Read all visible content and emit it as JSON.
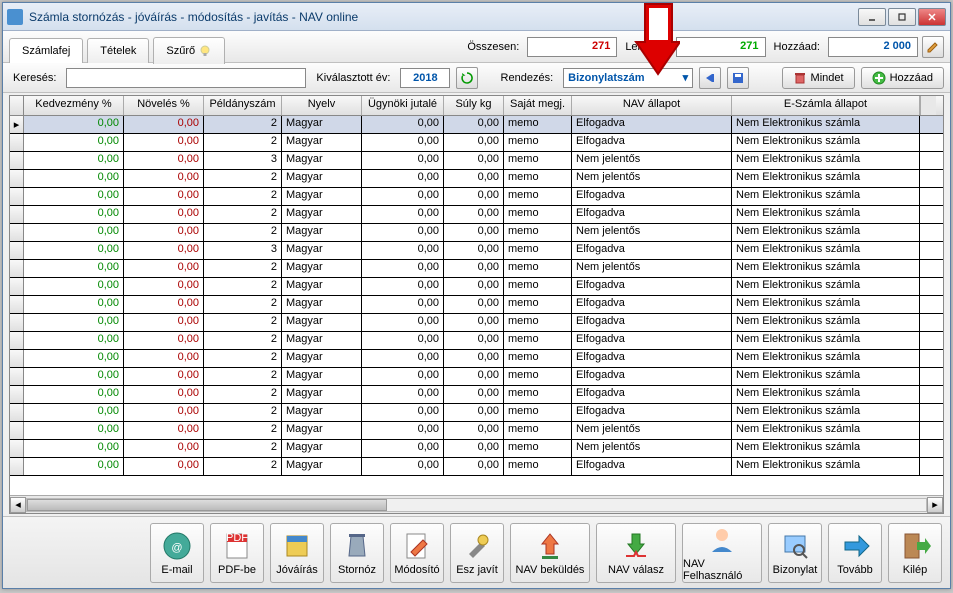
{
  "window": {
    "title": "Számla stornózás - jóváírás - módosítás - javítás - NAV online"
  },
  "tabs": {
    "t0": "Számlafej",
    "t1": "Tételek",
    "t2": "Szűrő"
  },
  "summary": {
    "osszesen_label": "Összesen:",
    "osszesen_value": "271",
    "lekerve_label": "Lekérve:",
    "lekerve_value": "271",
    "hozzaad_label": "Hozzáad:",
    "hozzaad_value": "2 000"
  },
  "toolbar2": {
    "kereses_label": "Keresés:",
    "kivalasztott_ev_label": "Kiválasztott év:",
    "year": "2018",
    "rendezes_label": "Rendezés:",
    "sort_field": "Bizonylatszám",
    "mindet_label": "Mindet",
    "hozzaad_label": "Hozzáad"
  },
  "columns": {
    "c0": "Kedvezmény %",
    "c1": "Növelés %",
    "c2": "Példányszám",
    "c3": "Nyelv",
    "c4": "Ügynöki jutalé",
    "c5": "Súly kg",
    "c6": "Saját megj.",
    "c7": "NAV állapot",
    "c8": "E-Számla állapot"
  },
  "rows": [
    {
      "kedv": "0,00",
      "nov": "0,00",
      "peld": "2",
      "nyelv": "Magyar",
      "jut": "0,00",
      "suly": "0,00",
      "megj": "memo",
      "nav": "Elfogadva",
      "esz": "Nem Elektronikus számla",
      "sel": true
    },
    {
      "kedv": "0,00",
      "nov": "0,00",
      "peld": "2",
      "nyelv": "Magyar",
      "jut": "0,00",
      "suly": "0,00",
      "megj": "memo",
      "nav": "Elfogadva",
      "esz": "Nem Elektronikus számla"
    },
    {
      "kedv": "0,00",
      "nov": "0,00",
      "peld": "3",
      "nyelv": "Magyar",
      "jut": "0,00",
      "suly": "0,00",
      "megj": "memo",
      "nav": "Nem jelentős",
      "esz": "Nem Elektronikus számla"
    },
    {
      "kedv": "0,00",
      "nov": "0,00",
      "peld": "2",
      "nyelv": "Magyar",
      "jut": "0,00",
      "suly": "0,00",
      "megj": "memo",
      "nav": "Nem jelentős",
      "esz": "Nem Elektronikus számla"
    },
    {
      "kedv": "0,00",
      "nov": "0,00",
      "peld": "2",
      "nyelv": "Magyar",
      "jut": "0,00",
      "suly": "0,00",
      "megj": "memo",
      "nav": "Elfogadva",
      "esz": "Nem Elektronikus számla"
    },
    {
      "kedv": "0,00",
      "nov": "0,00",
      "peld": "2",
      "nyelv": "Magyar",
      "jut": "0,00",
      "suly": "0,00",
      "megj": "memo",
      "nav": "Elfogadva",
      "esz": "Nem Elektronikus számla"
    },
    {
      "kedv": "0,00",
      "nov": "0,00",
      "peld": "2",
      "nyelv": "Magyar",
      "jut": "0,00",
      "suly": "0,00",
      "megj": "memo",
      "nav": "Nem jelentős",
      "esz": "Nem Elektronikus számla"
    },
    {
      "kedv": "0,00",
      "nov": "0,00",
      "peld": "3",
      "nyelv": "Magyar",
      "jut": "0,00",
      "suly": "0,00",
      "megj": "memo",
      "nav": "Elfogadva",
      "esz": "Nem Elektronikus számla"
    },
    {
      "kedv": "0,00",
      "nov": "0,00",
      "peld": "2",
      "nyelv": "Magyar",
      "jut": "0,00",
      "suly": "0,00",
      "megj": "memo",
      "nav": "Nem jelentős",
      "esz": "Nem Elektronikus számla"
    },
    {
      "kedv": "0,00",
      "nov": "0,00",
      "peld": "2",
      "nyelv": "Magyar",
      "jut": "0,00",
      "suly": "0,00",
      "megj": "memo",
      "nav": "Elfogadva",
      "esz": "Nem Elektronikus számla"
    },
    {
      "kedv": "0,00",
      "nov": "0,00",
      "peld": "2",
      "nyelv": "Magyar",
      "jut": "0,00",
      "suly": "0,00",
      "megj": "memo",
      "nav": "Elfogadva",
      "esz": "Nem Elektronikus számla"
    },
    {
      "kedv": "0,00",
      "nov": "0,00",
      "peld": "2",
      "nyelv": "Magyar",
      "jut": "0,00",
      "suly": "0,00",
      "megj": "memo",
      "nav": "Elfogadva",
      "esz": "Nem Elektronikus számla"
    },
    {
      "kedv": "0,00",
      "nov": "0,00",
      "peld": "2",
      "nyelv": "Magyar",
      "jut": "0,00",
      "suly": "0,00",
      "megj": "memo",
      "nav": "Elfogadva",
      "esz": "Nem Elektronikus számla"
    },
    {
      "kedv": "0,00",
      "nov": "0,00",
      "peld": "2",
      "nyelv": "Magyar",
      "jut": "0,00",
      "suly": "0,00",
      "megj": "memo",
      "nav": "Elfogadva",
      "esz": "Nem Elektronikus számla"
    },
    {
      "kedv": "0,00",
      "nov": "0,00",
      "peld": "2",
      "nyelv": "Magyar",
      "jut": "0,00",
      "suly": "0,00",
      "megj": "memo",
      "nav": "Elfogadva",
      "esz": "Nem Elektronikus számla"
    },
    {
      "kedv": "0,00",
      "nov": "0,00",
      "peld": "2",
      "nyelv": "Magyar",
      "jut": "0,00",
      "suly": "0,00",
      "megj": "memo",
      "nav": "Elfogadva",
      "esz": "Nem Elektronikus számla"
    },
    {
      "kedv": "0,00",
      "nov": "0,00",
      "peld": "2",
      "nyelv": "Magyar",
      "jut": "0,00",
      "suly": "0,00",
      "megj": "memo",
      "nav": "Elfogadva",
      "esz": "Nem Elektronikus számla"
    },
    {
      "kedv": "0,00",
      "nov": "0,00",
      "peld": "2",
      "nyelv": "Magyar",
      "jut": "0,00",
      "suly": "0,00",
      "megj": "memo",
      "nav": "Nem jelentős",
      "esz": "Nem Elektronikus számla"
    },
    {
      "kedv": "0,00",
      "nov": "0,00",
      "peld": "2",
      "nyelv": "Magyar",
      "jut": "0,00",
      "suly": "0,00",
      "megj": "memo",
      "nav": "Nem jelentős",
      "esz": "Nem Elektronikus számla"
    },
    {
      "kedv": "0,00",
      "nov": "0,00",
      "peld": "2",
      "nyelv": "Magyar",
      "jut": "0,00",
      "suly": "0,00",
      "megj": "memo",
      "nav": "Elfogadva",
      "esz": "Nem Elektronikus számla"
    }
  ],
  "bottom": {
    "email": "E-mail",
    "pdfbe": "PDF-be",
    "jovairas": "Jóváírás",
    "stornoz": "Stornóz",
    "modosito": "Módosító",
    "eszjavit": "Esz javít",
    "navbekuldes": "NAV beküldés",
    "navvalasz": "NAV válasz",
    "navfelhasznalo": "NAV Felhasználó",
    "bizonylat": "Bizonylat",
    "tovabb": "Tovább",
    "kilep": "Kilép"
  }
}
